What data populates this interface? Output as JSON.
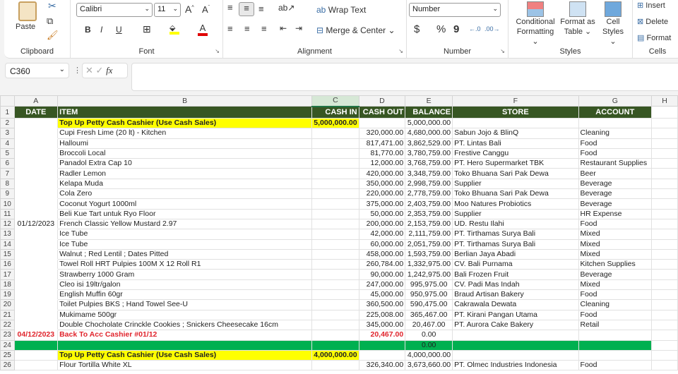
{
  "ribbon": {
    "clipboard": {
      "paste": "Paste",
      "label": "Clipboard"
    },
    "font": {
      "name": "Calibri",
      "size": "11",
      "bold": "B",
      "italic": "I",
      "underline": "U",
      "label": "Font",
      "fill_color": "#ffff00",
      "font_color": "#e00000"
    },
    "alignment": {
      "wrap_text": "Wrap Text",
      "merge_center": "Merge & Center",
      "label": "Alignment"
    },
    "number": {
      "format": "Number",
      "currency": "$",
      "percent": "%",
      "comma": "9",
      "label": "Number"
    },
    "styles": {
      "conditional": "Conditional",
      "conditional2": "Formatting",
      "format_as": "Format as",
      "format_as2": "Table",
      "cell": "Cell",
      "cell2": "Styles",
      "label": "Styles"
    },
    "cells": {
      "insert": "Insert",
      "delete": "Delete",
      "format": "Format",
      "label": "Cells"
    }
  },
  "formula_bar": {
    "name_box": "C360",
    "fx": "fx",
    "value": ""
  },
  "columns": [
    "A",
    "B",
    "C",
    "D",
    "E",
    "F",
    "G",
    "H"
  ],
  "headers": [
    "DATE",
    "ITEM",
    "CASH IN",
    "CASH OUT",
    "BALANCE",
    "STORE",
    "ACCOUNT"
  ],
  "rows": [
    {
      "n": "2",
      "date": "",
      "item": "Top Up Petty Cash Cashier (Use Cash Sales)",
      "in": "5,000,000.00",
      "out": "",
      "bal": "5,000,000.00",
      "store": "",
      "acct": "",
      "style": "topup"
    },
    {
      "n": "3",
      "date": "",
      "item": "Cupi Fresh Lime (20 lt) - Kitchen",
      "in": "",
      "out": "320,000.00",
      "bal": "4,680,000.00",
      "store": "Sabun Jojo & BlinQ",
      "acct": "Cleaning"
    },
    {
      "n": "4",
      "date": "",
      "item": "Halloumi",
      "in": "",
      "out": "817,471.00",
      "bal": "3,862,529.00",
      "store": "PT. Lintas Bali",
      "acct": "Food"
    },
    {
      "n": "5",
      "date": "",
      "item": "Broccoli Local",
      "in": "",
      "out": "81,770.00",
      "bal": "3,780,759.00",
      "store": "Frestive Canggu",
      "acct": "Food"
    },
    {
      "n": "6",
      "date": "",
      "item": "Panadol Extra Cap 10",
      "in": "",
      "out": "12,000.00",
      "bal": "3,768,759.00",
      "store": "PT. Hero Supermarket TBK",
      "acct": "Restaurant Supplies"
    },
    {
      "n": "7",
      "date": "",
      "item": "Radler Lemon",
      "in": "",
      "out": "420,000.00",
      "bal": "3,348,759.00",
      "store": "Toko Bhuana Sari Pak Dewa",
      "acct": "Beer"
    },
    {
      "n": "8",
      "date": "",
      "item": "Kelapa Muda",
      "in": "",
      "out": "350,000.00",
      "bal": "2,998,759.00",
      "store": "Supplier",
      "acct": "Beverage"
    },
    {
      "n": "9",
      "date": "",
      "item": "Cola Zero",
      "in": "",
      "out": "220,000.00",
      "bal": "2,778,759.00",
      "store": "Toko Bhuana Sari Pak Dewa",
      "acct": "Beverage"
    },
    {
      "n": "10",
      "date": "",
      "item": "Coconut Yogurt 1000ml",
      "in": "",
      "out": "375,000.00",
      "bal": "2,403,759.00",
      "store": "Moo Natures Probiotics",
      "acct": "Beverage"
    },
    {
      "n": "11",
      "date": "",
      "item": "Beli Kue Tart untuk Ryo Floor",
      "in": "",
      "out": "50,000.00",
      "bal": "2,353,759.00",
      "store": "Supplier",
      "acct": "HR Expense"
    },
    {
      "n": "12",
      "date": "01/12/2023",
      "item": "French Classic Yellow Mustard 2.97",
      "in": "",
      "out": "200,000.00",
      "bal": "2,153,759.00",
      "store": "UD. Restu Ilahi",
      "acct": "Food"
    },
    {
      "n": "13",
      "date": "",
      "item": "Ice Tube",
      "in": "",
      "out": "42,000.00",
      "bal": "2,111,759.00",
      "store": "PT. Tirthamas Surya Bali",
      "acct": "Mixed"
    },
    {
      "n": "14",
      "date": "",
      "item": "Ice Tube",
      "in": "",
      "out": "60,000.00",
      "bal": "2,051,759.00",
      "store": "PT. Tirthamas Surya Bali",
      "acct": "Mixed"
    },
    {
      "n": "15",
      "date": "",
      "item": "Walnut ; Red Lentil ; Dates Pitted",
      "in": "",
      "out": "458,000.00",
      "bal": "1,593,759.00",
      "store": "Berlian Jaya Abadi",
      "acct": "Mixed"
    },
    {
      "n": "16",
      "date": "",
      "item": "Towel Roll HRT Pulpies 100M X 12 Roll R1",
      "in": "",
      "out": "260,784.00",
      "bal": "1,332,975.00",
      "store": "CV. Bali Purnama",
      "acct": "Kitchen Supplies"
    },
    {
      "n": "17",
      "date": "",
      "item": "Strawberry 1000 Gram",
      "in": "",
      "out": "90,000.00",
      "bal": "1,242,975.00",
      "store": "Bali Frozen Fruit",
      "acct": "Beverage"
    },
    {
      "n": "18",
      "date": "",
      "item": "Cleo isi 19ltr/galon",
      "in": "",
      "out": "247,000.00",
      "bal": "995,975.00",
      "store": "CV. Padi Mas Indah",
      "acct": "Mixed"
    },
    {
      "n": "19",
      "date": "",
      "item": "English Muffin 60gr",
      "in": "",
      "out": "45,000.00",
      "bal": "950,975.00",
      "store": "Braud Artisan Bakery",
      "acct": "Food"
    },
    {
      "n": "20",
      "date": "",
      "item": "Toilet Pulpies BKS ; Hand Towel See-U",
      "in": "",
      "out": "360,500.00",
      "bal": "590,475.00",
      "store": "Cakrawala Dewata",
      "acct": "Cleaning"
    },
    {
      "n": "21",
      "date": "",
      "item": "Mukimame 500gr",
      "in": "",
      "out": "225,008.00",
      "bal": "365,467.00",
      "store": "PT. Kirani Pangan Utama",
      "acct": "Food"
    },
    {
      "n": "22",
      "date": "",
      "item": "Double Chocholate Crinckle Cookies ; Snickers Cheesecake 16cm",
      "in": "",
      "out": "345,000.00",
      "bal": "20,467.00",
      "store": "PT. Aurora Cake Bakery",
      "acct": "Retail"
    },
    {
      "n": "23",
      "date": "04/12/2023",
      "item": "Back To Acc Cashier #01/12",
      "in": "",
      "out": "20,467.00",
      "bal": "0.00",
      "store": "",
      "acct": "",
      "style": "back"
    },
    {
      "n": "24",
      "date": "",
      "item": "",
      "in": "",
      "out": "",
      "bal": "0.00",
      "store": "",
      "acct": "",
      "style": "green"
    },
    {
      "n": "25",
      "date": "",
      "item": "Top Up Petty Cash Cashier (Use Cash Sales)",
      "in": "4,000,000.00",
      "out": "",
      "bal": "4,000,000.00",
      "store": "",
      "acct": "",
      "style": "topup"
    },
    {
      "n": "26",
      "date": "",
      "item": "Flour Tortilla White XL",
      "in": "",
      "out": "326,340.00",
      "bal": "3,673,660.00",
      "store": "PT. Olmec Industries Indonesia",
      "acct": "Food"
    }
  ]
}
